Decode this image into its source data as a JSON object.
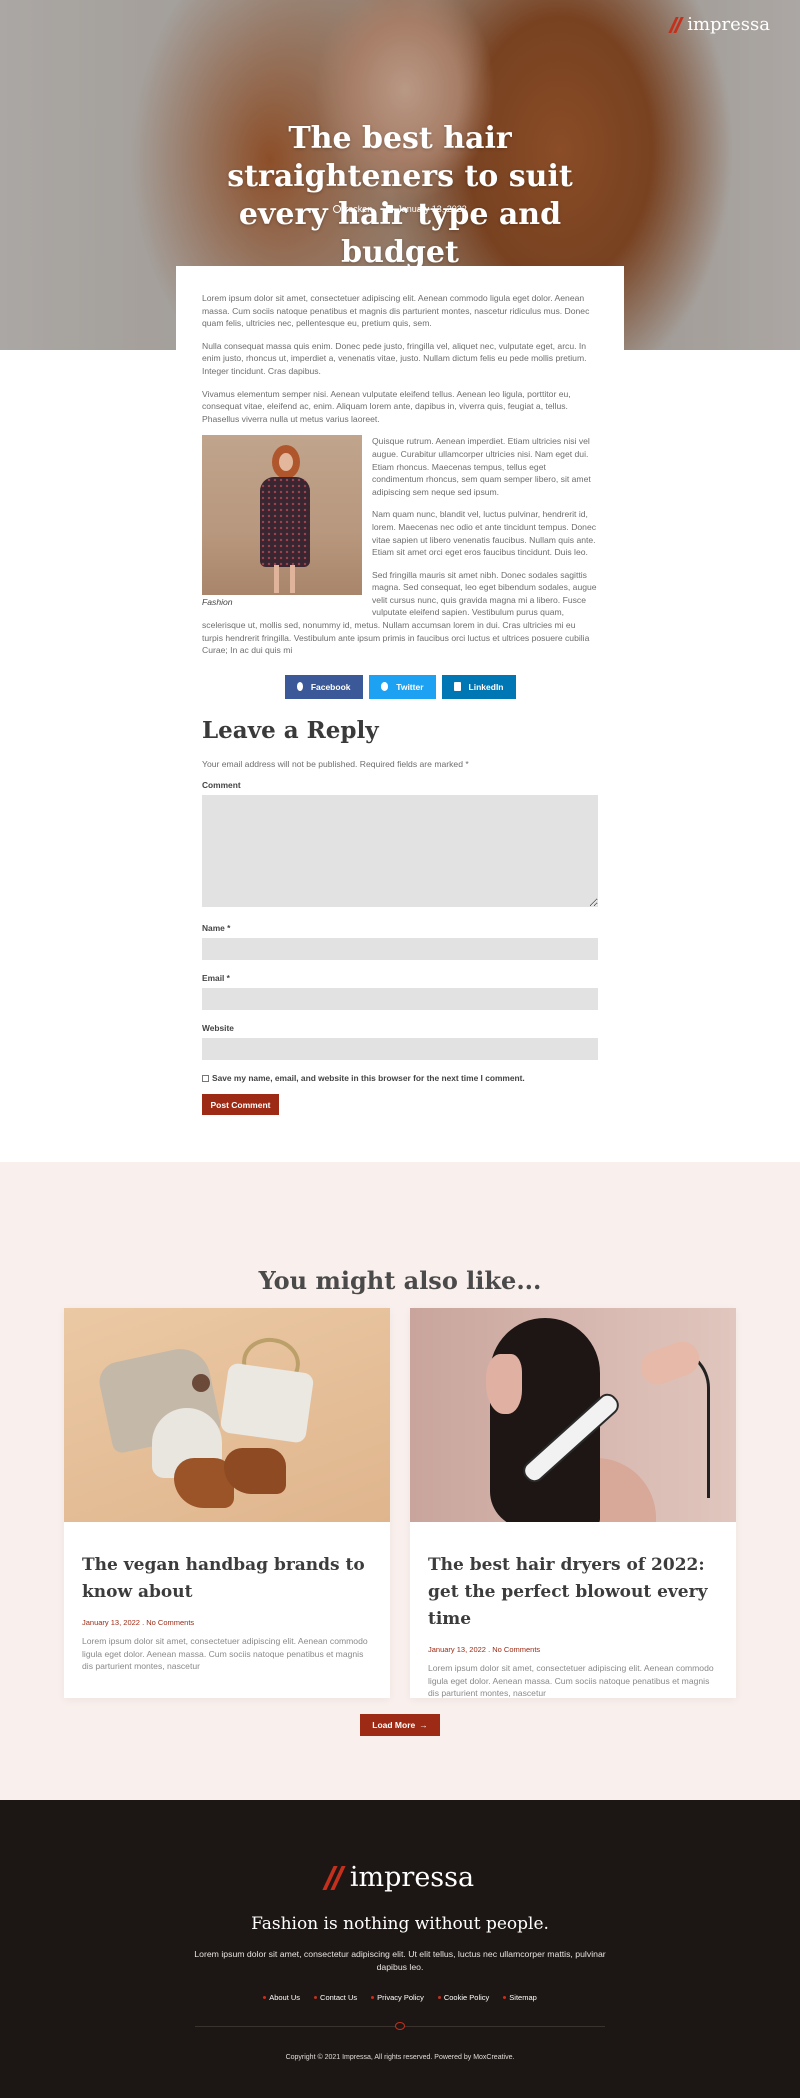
{
  "brand": {
    "name": "impressa"
  },
  "hero": {
    "title": "The best hair straighteners to suit every hair type and budget",
    "author": "rocken",
    "date": "January 13, 2022"
  },
  "article": {
    "paragraphs": [
      "Lorem ipsum dolor sit amet, consectetuer adipiscing elit. Aenean commodo ligula eget dolor. Aenean massa. Cum sociis natoque penatibus et magnis dis parturient montes, nascetur ridiculus mus. Donec quam felis, ultricies nec, pellentesque eu, pretium quis, sem.",
      "Nulla consequat massa quis enim. Donec pede justo, fringilla vel, aliquet nec, vulputate eget, arcu. In enim justo, rhoncus ut, imperdiet a, venenatis vitae, justo. Nullam dictum felis eu pede mollis pretium. Integer tincidunt. Cras dapibus.",
      "Vivamus elementum semper nisi. Aenean vulputate eleifend tellus. Aenean leo ligula, porttitor eu, consequat vitae, eleifend ac, enim. Aliquam lorem ante, dapibus in, viverra quis, feugiat a, tellus. Phasellus viverra nulla ut metus varius laoreet.",
      "Quisque rutrum. Aenean imperdiet. Etiam ultricies nisi vel augue. Curabitur ullamcorper ultricies nisi. Nam eget dui. Etiam rhoncus. Maecenas tempus, tellus eget condimentum rhoncus, sem quam semper libero, sit amet adipiscing sem neque sed ipsum.",
      "Nam quam nunc, blandit vel, luctus pulvinar, hendrerit id, lorem. Maecenas nec odio et ante tincidunt tempus. Donec vitae sapien ut libero venenatis faucibus. Nullam quis ante. Etiam sit amet orci eget eros faucibus tincidunt. Duis leo.",
      "Sed fringilla mauris sit amet nibh. Donec sodales sagittis magna. Sed consequat, leo eget bibendum sodales, augue velit cursus nunc, quis gravida magna mi a libero. Fusce vulputate eleifend sapien. Vestibulum purus quam, scelerisque ut, mollis sed, nonummy id, metus. Nullam accumsan lorem in dui. Cras ultricies mi eu turpis hendrerit fringilla. Vestibulum ante ipsum primis in faucibus orci luctus et ultrices posuere cubilia Curae; In ac dui quis mi"
    ],
    "figure_caption": "Fashion"
  },
  "share": {
    "facebook": "Facebook",
    "twitter": "Twitter",
    "linkedin": "LinkedIn"
  },
  "reply": {
    "title": "Leave a Reply",
    "notes": "Your email address will not be published. Required fields are marked *",
    "comment_label": "Comment",
    "name_label": "Name *",
    "email_label": "Email *",
    "website_label": "Website",
    "cookies_label": "Save my name, email, and website in this browser for the next time I comment.",
    "submit": "Post Comment"
  },
  "related": {
    "title": "You might also like...",
    "cards": [
      {
        "title": "The vegan handbag brands to know about",
        "date": "January 13, 2022",
        "sep": ".",
        "comments": "No Comments",
        "excerpt": "Lorem ipsum dolor sit amet, consectetuer adipiscing elit. Aenean commodo ligula eget dolor. Aenean massa. Cum sociis natoque penatibus et magnis dis parturient montes, nascetur"
      },
      {
        "title": "The best hair dryers of 2022: get the perfect blowout every time",
        "date": "January 13, 2022",
        "sep": ".",
        "comments": "No Comments",
        "excerpt": "Lorem ipsum dolor sit amet, consectetuer adipiscing elit. Aenean commodo ligula eget dolor. Aenean massa. Cum sociis natoque penatibus et magnis dis parturient montes, nascetur"
      }
    ],
    "load_more": "Load More",
    "load_more_arrow": "→"
  },
  "footer": {
    "tagline": "Fashion is nothing without people.",
    "description": "Lorem ipsum dolor sit amet, consectetur adipiscing elit. Ut elit tellus, luctus nec ullamcorper mattis, pulvinar dapibus leo.",
    "links": [
      "About Us",
      "Contact Us",
      "Privacy Policy",
      "Cookie Policy",
      "Sitemap"
    ],
    "copyright": "Copyright © 2021 Impressa, All rights reserved. Powered by MoxCreative."
  },
  "colors": {
    "accent": "#9c2a14",
    "related_bg": "#f9efec",
    "footer_bg": "#1c1714",
    "facebook": "#3b5998",
    "twitter": "#1da1f2",
    "linkedin": "#0077b5"
  }
}
